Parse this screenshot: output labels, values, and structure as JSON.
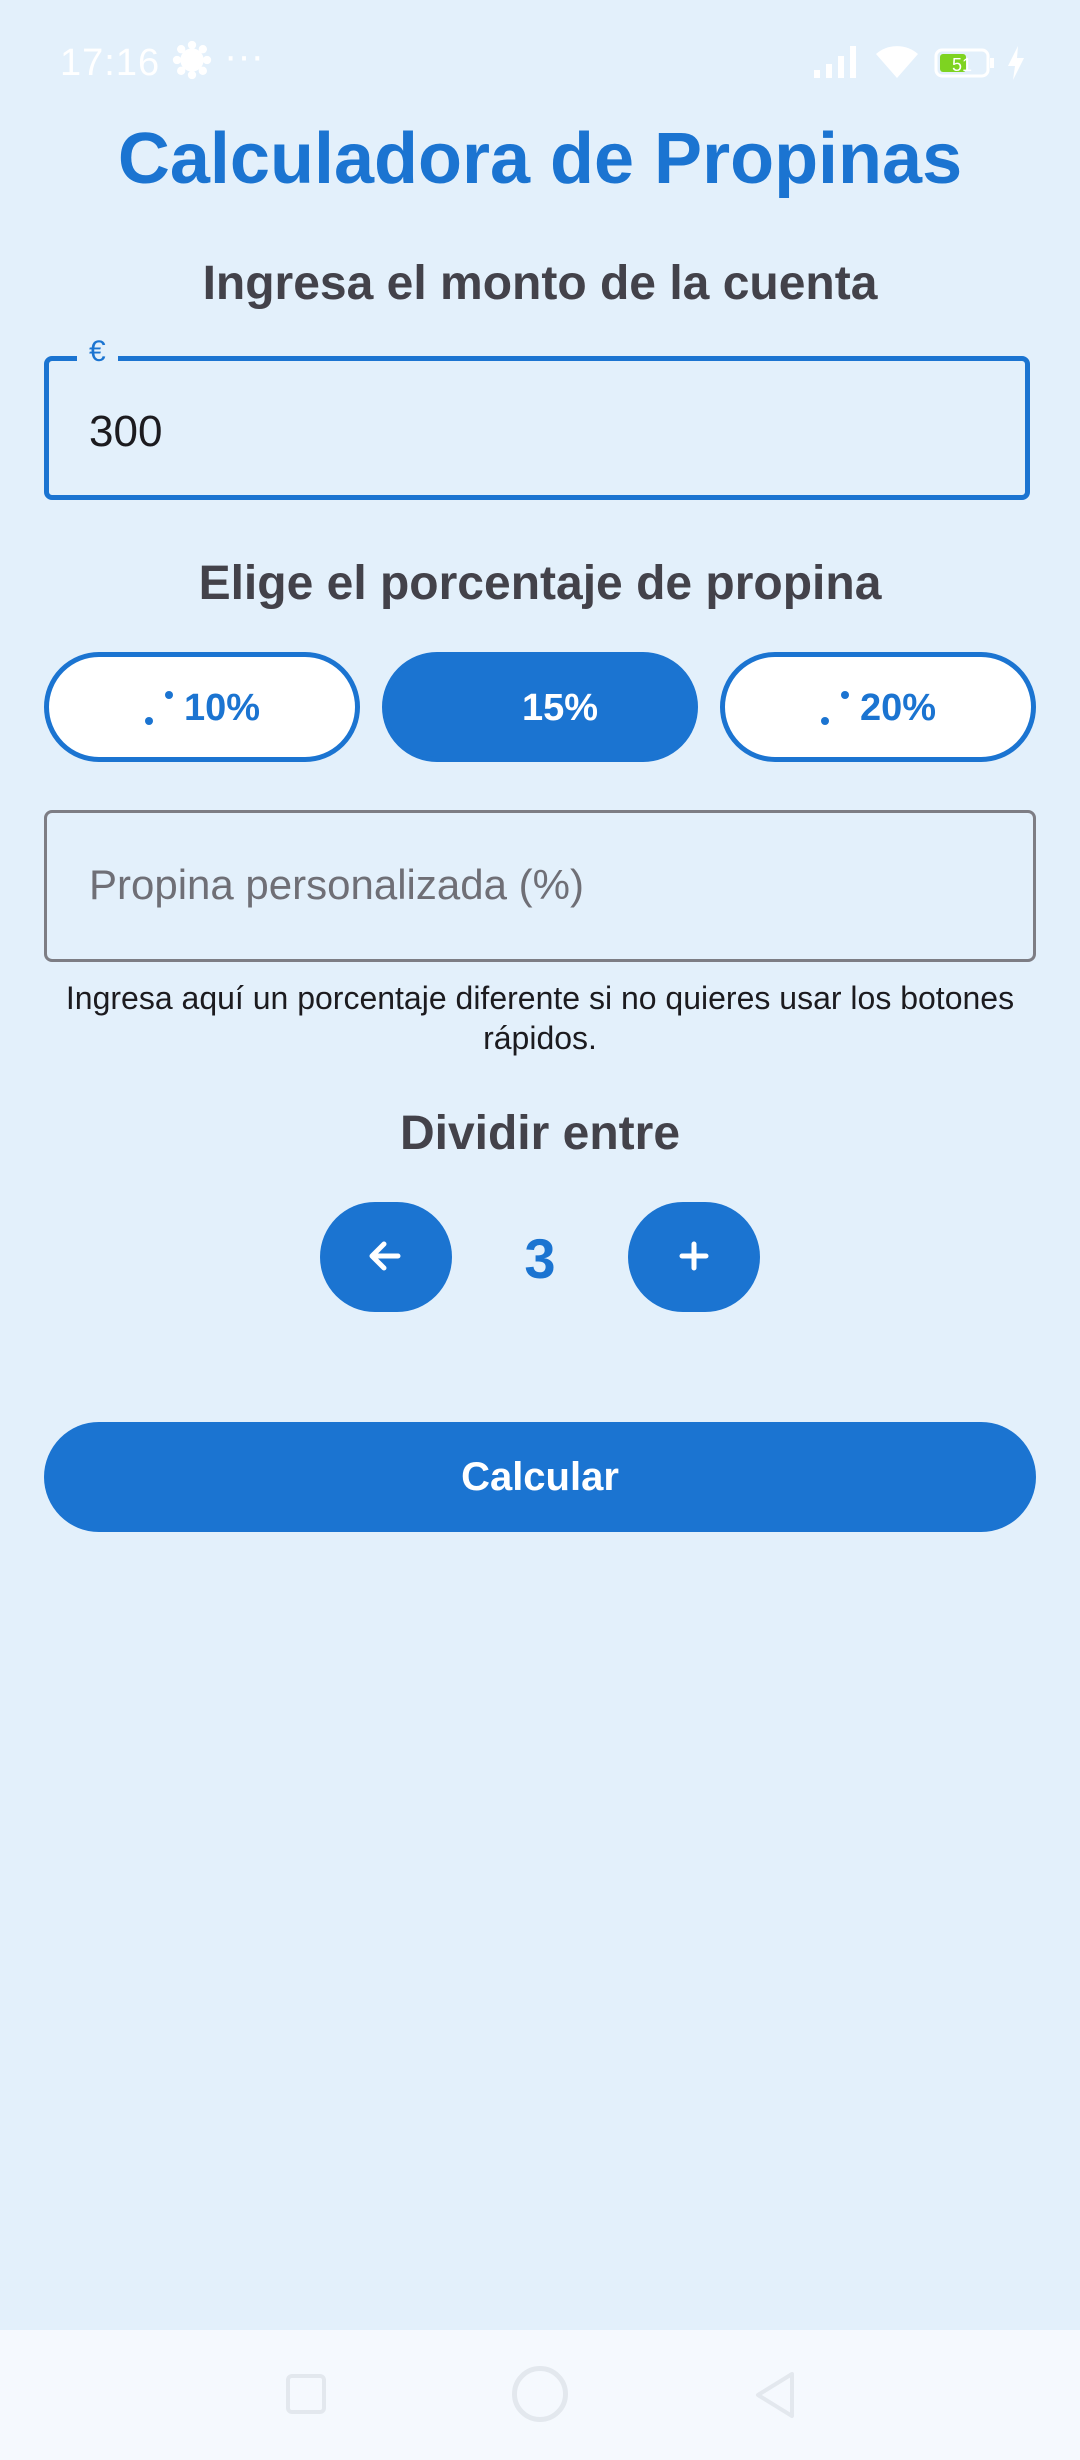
{
  "status_bar": {
    "time": "17:16",
    "dots": "···",
    "battery": "51",
    "icons": [
      "gear-icon",
      "signal-icon",
      "wifi-icon",
      "battery-icon",
      "charging-icon"
    ]
  },
  "app": {
    "title": "Calculadora de Propinas"
  },
  "amount": {
    "heading": "Ingresa el monto de la cuenta",
    "label": "€",
    "value": "300"
  },
  "tip": {
    "heading": "Elige el porcentaje de propina",
    "options": [
      {
        "label": "10%",
        "selected": false
      },
      {
        "label": "15%",
        "selected": true
      },
      {
        "label": "20%",
        "selected": false
      }
    ],
    "custom_placeholder": "Propina personalizada (%)",
    "helper": "Ingresa aquí un porcentaje diferente si no quieres usar los botones rápidos."
  },
  "split": {
    "heading": "Dividir entre",
    "count": "3"
  },
  "calculate_label": "Calcular",
  "colors": {
    "accent": "#1b74d1",
    "background": "#e3f0fb",
    "heading": "#43424a"
  }
}
